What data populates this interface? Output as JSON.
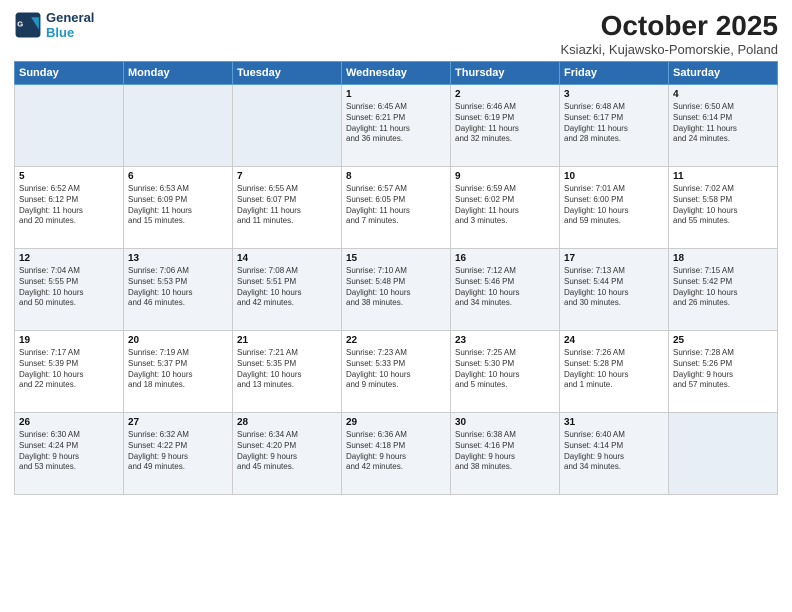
{
  "logo": {
    "line1": "General",
    "line2": "Blue"
  },
  "title": "October 2025",
  "location": "Ksiazki, Kujawsko-Pomorskie, Poland",
  "weekdays": [
    "Sunday",
    "Monday",
    "Tuesday",
    "Wednesday",
    "Thursday",
    "Friday",
    "Saturday"
  ],
  "weeks": [
    [
      {
        "day": "",
        "info": ""
      },
      {
        "day": "",
        "info": ""
      },
      {
        "day": "",
        "info": ""
      },
      {
        "day": "1",
        "info": "Sunrise: 6:45 AM\nSunset: 6:21 PM\nDaylight: 11 hours\nand 36 minutes."
      },
      {
        "day": "2",
        "info": "Sunrise: 6:46 AM\nSunset: 6:19 PM\nDaylight: 11 hours\nand 32 minutes."
      },
      {
        "day": "3",
        "info": "Sunrise: 6:48 AM\nSunset: 6:17 PM\nDaylight: 11 hours\nand 28 minutes."
      },
      {
        "day": "4",
        "info": "Sunrise: 6:50 AM\nSunset: 6:14 PM\nDaylight: 11 hours\nand 24 minutes."
      }
    ],
    [
      {
        "day": "5",
        "info": "Sunrise: 6:52 AM\nSunset: 6:12 PM\nDaylight: 11 hours\nand 20 minutes."
      },
      {
        "day": "6",
        "info": "Sunrise: 6:53 AM\nSunset: 6:09 PM\nDaylight: 11 hours\nand 15 minutes."
      },
      {
        "day": "7",
        "info": "Sunrise: 6:55 AM\nSunset: 6:07 PM\nDaylight: 11 hours\nand 11 minutes."
      },
      {
        "day": "8",
        "info": "Sunrise: 6:57 AM\nSunset: 6:05 PM\nDaylight: 11 hours\nand 7 minutes."
      },
      {
        "day": "9",
        "info": "Sunrise: 6:59 AM\nSunset: 6:02 PM\nDaylight: 11 hours\nand 3 minutes."
      },
      {
        "day": "10",
        "info": "Sunrise: 7:01 AM\nSunset: 6:00 PM\nDaylight: 10 hours\nand 59 minutes."
      },
      {
        "day": "11",
        "info": "Sunrise: 7:02 AM\nSunset: 5:58 PM\nDaylight: 10 hours\nand 55 minutes."
      }
    ],
    [
      {
        "day": "12",
        "info": "Sunrise: 7:04 AM\nSunset: 5:55 PM\nDaylight: 10 hours\nand 50 minutes."
      },
      {
        "day": "13",
        "info": "Sunrise: 7:06 AM\nSunset: 5:53 PM\nDaylight: 10 hours\nand 46 minutes."
      },
      {
        "day": "14",
        "info": "Sunrise: 7:08 AM\nSunset: 5:51 PM\nDaylight: 10 hours\nand 42 minutes."
      },
      {
        "day": "15",
        "info": "Sunrise: 7:10 AM\nSunset: 5:48 PM\nDaylight: 10 hours\nand 38 minutes."
      },
      {
        "day": "16",
        "info": "Sunrise: 7:12 AM\nSunset: 5:46 PM\nDaylight: 10 hours\nand 34 minutes."
      },
      {
        "day": "17",
        "info": "Sunrise: 7:13 AM\nSunset: 5:44 PM\nDaylight: 10 hours\nand 30 minutes."
      },
      {
        "day": "18",
        "info": "Sunrise: 7:15 AM\nSunset: 5:42 PM\nDaylight: 10 hours\nand 26 minutes."
      }
    ],
    [
      {
        "day": "19",
        "info": "Sunrise: 7:17 AM\nSunset: 5:39 PM\nDaylight: 10 hours\nand 22 minutes."
      },
      {
        "day": "20",
        "info": "Sunrise: 7:19 AM\nSunset: 5:37 PM\nDaylight: 10 hours\nand 18 minutes."
      },
      {
        "day": "21",
        "info": "Sunrise: 7:21 AM\nSunset: 5:35 PM\nDaylight: 10 hours\nand 13 minutes."
      },
      {
        "day": "22",
        "info": "Sunrise: 7:23 AM\nSunset: 5:33 PM\nDaylight: 10 hours\nand 9 minutes."
      },
      {
        "day": "23",
        "info": "Sunrise: 7:25 AM\nSunset: 5:30 PM\nDaylight: 10 hours\nand 5 minutes."
      },
      {
        "day": "24",
        "info": "Sunrise: 7:26 AM\nSunset: 5:28 PM\nDaylight: 10 hours\nand 1 minute."
      },
      {
        "day": "25",
        "info": "Sunrise: 7:28 AM\nSunset: 5:26 PM\nDaylight: 9 hours\nand 57 minutes."
      }
    ],
    [
      {
        "day": "26",
        "info": "Sunrise: 6:30 AM\nSunset: 4:24 PM\nDaylight: 9 hours\nand 53 minutes."
      },
      {
        "day": "27",
        "info": "Sunrise: 6:32 AM\nSunset: 4:22 PM\nDaylight: 9 hours\nand 49 minutes."
      },
      {
        "day": "28",
        "info": "Sunrise: 6:34 AM\nSunset: 4:20 PM\nDaylight: 9 hours\nand 45 minutes."
      },
      {
        "day": "29",
        "info": "Sunrise: 6:36 AM\nSunset: 4:18 PM\nDaylight: 9 hours\nand 42 minutes."
      },
      {
        "day": "30",
        "info": "Sunrise: 6:38 AM\nSunset: 4:16 PM\nDaylight: 9 hours\nand 38 minutes."
      },
      {
        "day": "31",
        "info": "Sunrise: 6:40 AM\nSunset: 4:14 PM\nDaylight: 9 hours\nand 34 minutes."
      },
      {
        "day": "",
        "info": ""
      }
    ]
  ]
}
